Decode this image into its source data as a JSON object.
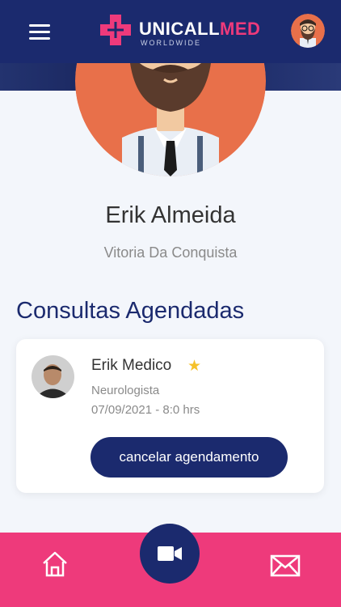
{
  "header": {
    "brand_main": "UNICALL",
    "brand_accent": "MED",
    "brand_sub": "WORLDWIDE",
    "menu_icon": "hamburger-menu-icon"
  },
  "profile": {
    "name": "Erik Almeida",
    "city": "Vitoria Da Conquista"
  },
  "appointments": {
    "title": "Consultas Agendadas",
    "items": [
      {
        "doctor": "Erik Medico",
        "favorite_icon": "★",
        "specialty": "Neurologista",
        "datetime": "07/09/2021 - 8:0 hrs",
        "action_label": "cancelar agendamento"
      }
    ]
  },
  "bottom_nav": {
    "items": [
      "home-icon",
      "video-camera-icon",
      "mail-icon"
    ]
  },
  "colors": {
    "navy": "#1b2a6e",
    "pink": "#ee3a7b",
    "avatar_bg": "#e8704a",
    "star": "#f5c12a"
  }
}
